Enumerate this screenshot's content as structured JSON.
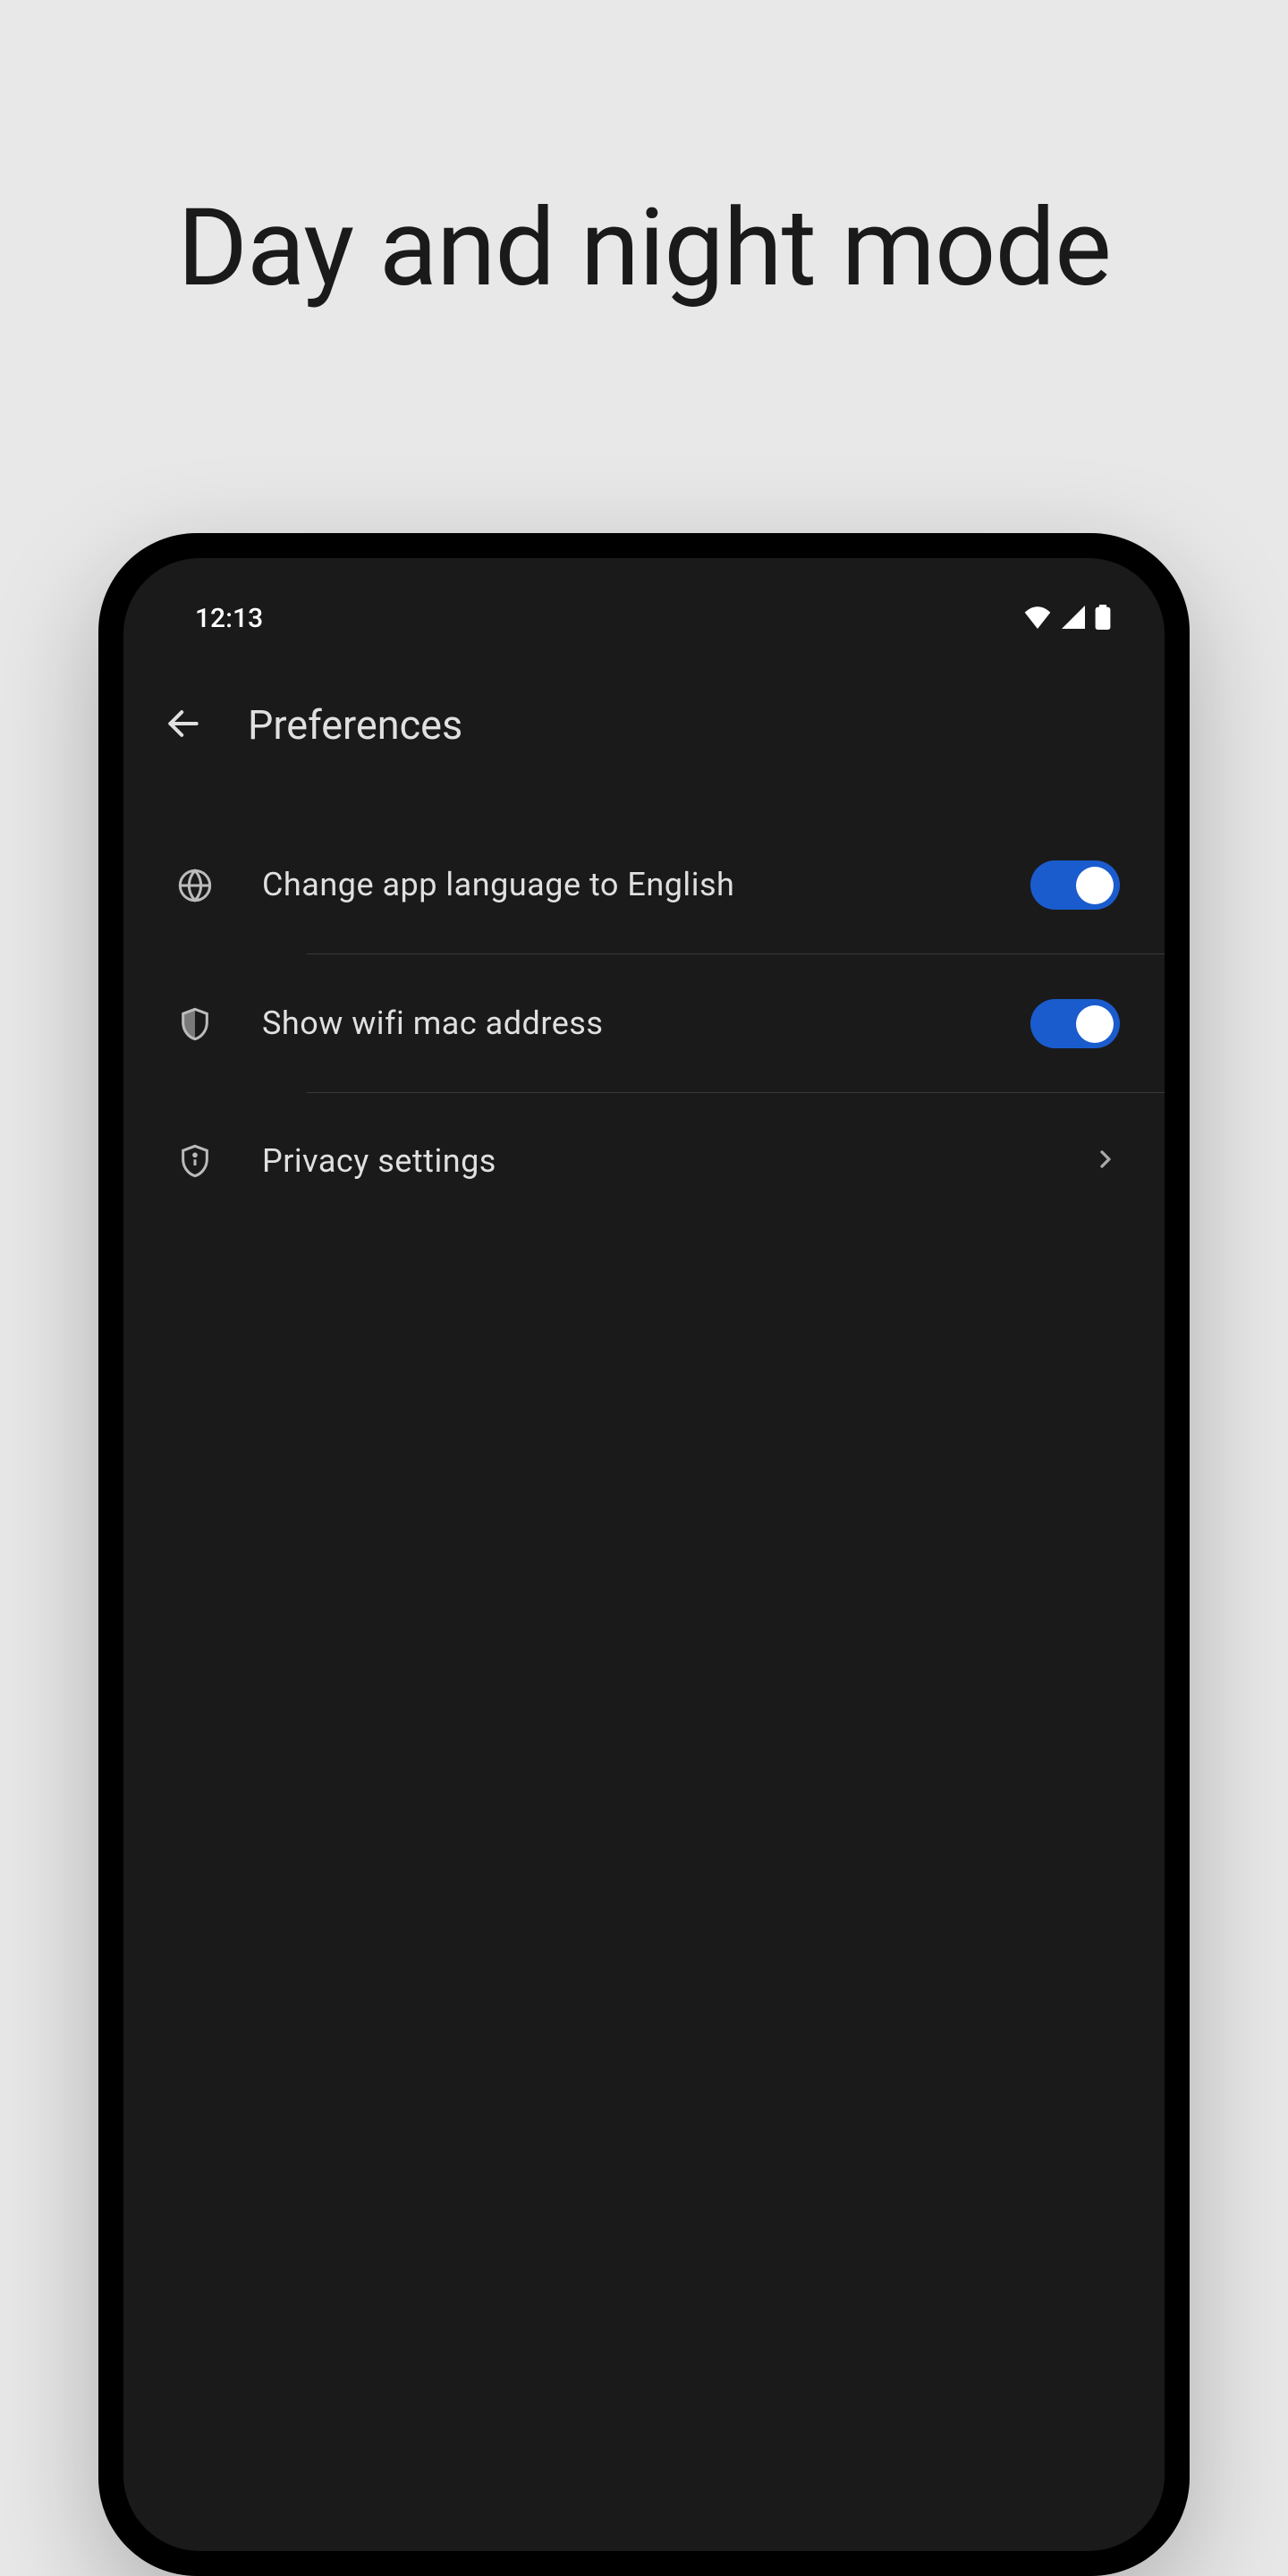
{
  "heading": "Day and night mode",
  "status": {
    "time": "12:13"
  },
  "appbar": {
    "title": "Preferences"
  },
  "settings": {
    "items": [
      {
        "label": "Change app language to English"
      },
      {
        "label": "Show wifi mac address"
      },
      {
        "label": "Privacy settings"
      }
    ]
  }
}
